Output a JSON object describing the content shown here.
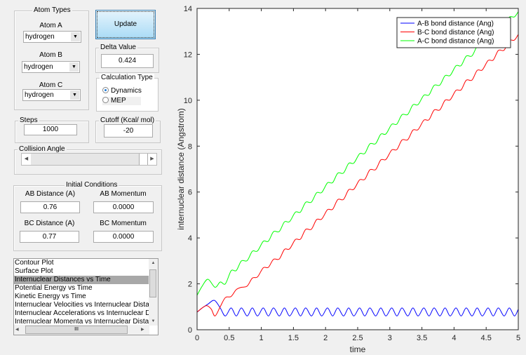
{
  "atom_types": {
    "title": "Atom Types",
    "atom_a_label": "Atom A",
    "atom_a": "hydrogen",
    "atom_b_label": "Atom B",
    "atom_b": "hydrogen",
    "atom_c_label": "Atom C",
    "atom_c": "hydrogen"
  },
  "update_label": "Update",
  "delta": {
    "title": "Delta Value",
    "value": "0.424"
  },
  "calc_type": {
    "title": "Calculation Type",
    "options": [
      "Dynamics",
      "MEP"
    ],
    "selected": "Dynamics"
  },
  "steps": {
    "title": "Steps",
    "value": "1000"
  },
  "cutoff": {
    "title": "Cutoff (Kcal/ mol)",
    "value": "-20"
  },
  "collision_angle": {
    "title": "Collision Angle",
    "slider_fraction": 1.0
  },
  "initial": {
    "title": "Initial Conditions",
    "ab_dist_label": "AB Distance (A)",
    "ab_dist": "0.76",
    "ab_mom_label": "AB Momentum",
    "ab_mom": "0.0000",
    "bc_dist_label": "BC Distance (A)",
    "bc_dist": "0.77",
    "bc_mom_label": "BC Momentum",
    "bc_mom": "0.0000"
  },
  "plot_list": {
    "items": [
      "Contour Plot",
      "Surface Plot",
      "Internuclear Distances vs Time",
      "Potential Energy vs Time",
      "Kinetic Energy vs Time",
      "Internuclear Velocities vs Internuclear Distance",
      "Internuclear Accelerations vs Internuclear Distance",
      "Internuclear Momenta vs Internuclear Distance"
    ],
    "selected_index": 2,
    "hscroll_grip": "III"
  },
  "chart_data": {
    "type": "line",
    "xlabel": "time",
    "ylabel": "internuclear distance (Angstrom)",
    "xlim": [
      0,
      5
    ],
    "ylim": [
      0,
      14
    ],
    "xticks": [
      "0",
      "0.5",
      "1",
      "1.5",
      "2",
      "2.5",
      "3",
      "3.5",
      "4",
      "4.5",
      "5"
    ],
    "yticks": [
      "0",
      "2",
      "4",
      "6",
      "8",
      "10",
      "12",
      "14"
    ],
    "legend_position": "top-right",
    "grid_x": [
      0.44,
      0.53,
      0.61,
      0.69,
      0.78,
      0.86,
      0.94,
      1.03,
      1.11,
      1.19,
      1.28,
      1.36,
      1.44,
      1.53,
      1.61,
      1.69,
      1.78,
      1.86,
      1.94,
      2.03,
      2.11,
      2.19,
      2.28,
      2.36,
      2.44,
      2.53,
      2.61,
      2.69,
      2.78,
      2.86,
      2.94,
      3.03,
      3.11,
      3.19,
      3.28,
      3.36,
      3.44,
      3.53,
      3.61,
      3.69,
      3.78,
      3.86,
      3.94,
      4.03,
      4.11,
      4.19,
      4.28,
      4.36,
      4.44,
      4.53,
      4.61,
      4.69,
      4.78,
      4.86,
      4.94,
      5.0
    ],
    "series": [
      {
        "name": "A-B bond distance (Ang)",
        "color": "#0000ff",
        "x_head": [
          0,
          0.08,
          0.17,
          0.27,
          0.36
        ],
        "y_head": [
          0.76,
          0.95,
          1.12,
          1.28,
          0.95
        ],
        "y": [
          0.6,
          0.95,
          0.6,
          0.95,
          0.6,
          0.95,
          0.6,
          0.95,
          0.6,
          0.95,
          0.6,
          0.95,
          0.6,
          0.95,
          0.6,
          0.95,
          0.6,
          0.95,
          0.6,
          0.95,
          0.6,
          0.95,
          0.6,
          0.95,
          0.6,
          0.95,
          0.6,
          0.95,
          0.6,
          0.95,
          0.6,
          0.95,
          0.6,
          0.95,
          0.6,
          0.95,
          0.6,
          0.95,
          0.6,
          0.95,
          0.6,
          0.95,
          0.6,
          0.95,
          0.6,
          0.95,
          0.6,
          0.95,
          0.6,
          0.95,
          0.6,
          0.95,
          0.6,
          0.95,
          0.6,
          0.9
        ]
      },
      {
        "name": "B-C bond distance (Ang)",
        "color": "#ff0000",
        "x_head": [
          0,
          0.08,
          0.15,
          0.22,
          0.28,
          0.36
        ],
        "y_head": [
          0.77,
          0.95,
          1.05,
          0.9,
          0.6,
          1.0
        ],
        "y": [
          1.4,
          1.45,
          1.75,
          1.85,
          1.9,
          2.25,
          2.3,
          2.7,
          2.72,
          3.07,
          3.08,
          3.5,
          3.52,
          3.93,
          3.95,
          4.37,
          4.38,
          4.8,
          4.82,
          5.23,
          5.25,
          5.67,
          5.68,
          6.1,
          6.12,
          6.53,
          6.55,
          6.97,
          6.98,
          7.4,
          7.42,
          7.83,
          7.85,
          8.27,
          8.28,
          8.7,
          8.72,
          9.13,
          9.15,
          9.57,
          9.58,
          10.0,
          10.02,
          10.43,
          10.45,
          10.87,
          10.88,
          11.3,
          11.32,
          11.73,
          11.75,
          12.17,
          12.18,
          12.6,
          12.62,
          12.87
        ]
      },
      {
        "name": "A-C bond distance (Ang)",
        "color": "#00ff00",
        "x_head": [
          0,
          0.08,
          0.17,
          0.28,
          0.36
        ],
        "y_head": [
          1.5,
          1.9,
          2.2,
          1.85,
          2.08
        ],
        "y": [
          2.0,
          2.57,
          2.58,
          3.0,
          3.01,
          3.42,
          3.43,
          3.85,
          3.86,
          4.27,
          4.28,
          4.7,
          4.71,
          5.12,
          5.13,
          5.55,
          5.56,
          5.97,
          5.98,
          6.4,
          6.41,
          6.82,
          6.83,
          7.25,
          7.26,
          7.67,
          7.68,
          8.1,
          8.11,
          8.52,
          8.53,
          8.95,
          8.96,
          9.37,
          9.38,
          9.8,
          9.81,
          10.22,
          10.23,
          10.65,
          10.66,
          11.07,
          11.08,
          11.5,
          11.51,
          11.92,
          11.93,
          12.35,
          12.36,
          12.77,
          12.78,
          13.2,
          13.21,
          13.62,
          13.63,
          13.86
        ]
      }
    ]
  }
}
